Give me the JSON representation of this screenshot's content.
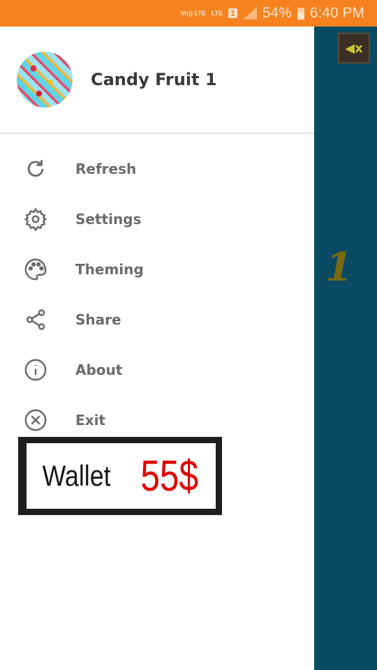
{
  "status_bar": {
    "volte": "Vo)) LTE",
    "lte": "LTE",
    "sim": "1",
    "battery": "54%",
    "time": "6:40 PM"
  },
  "drawer": {
    "title": "Candy Fruit 1",
    "items": [
      {
        "label": "Refresh",
        "icon": "refresh-icon"
      },
      {
        "label": "Settings",
        "icon": "gear-icon"
      },
      {
        "label": "Theming",
        "icon": "palette-icon"
      },
      {
        "label": "Share",
        "icon": "share-icon"
      },
      {
        "label": "About",
        "icon": "info-icon"
      },
      {
        "label": "Exit",
        "icon": "close-circle-icon"
      }
    ]
  },
  "wallet": {
    "label": "Wallet",
    "amount": "55$"
  },
  "game": {
    "level": "1"
  },
  "colors": {
    "status_bar": "#f5821f",
    "background": "#0b4a63",
    "wallet_amount": "#e00000"
  }
}
